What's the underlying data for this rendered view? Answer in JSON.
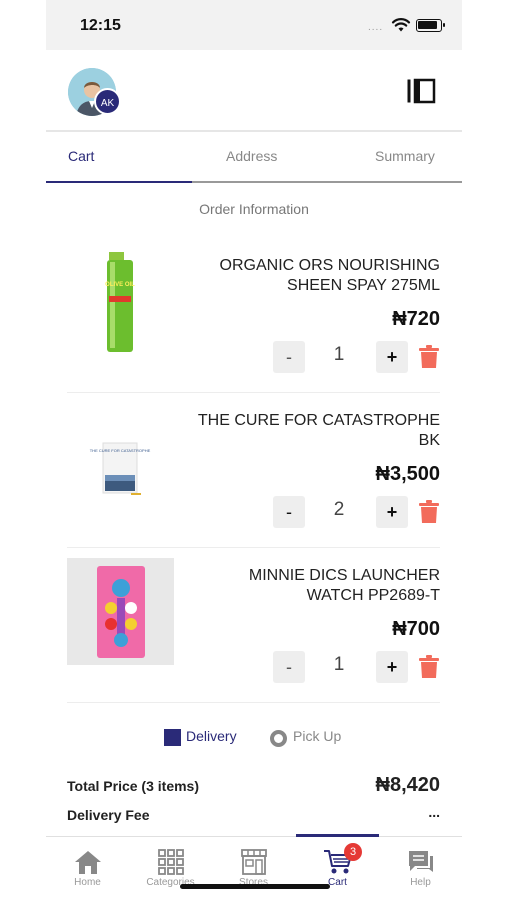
{
  "status_bar": {
    "time": "12:15",
    "dots": "...."
  },
  "header": {
    "avatar_initials": "AK"
  },
  "tabs": [
    {
      "label": "Cart",
      "active": true
    },
    {
      "label": "Address",
      "active": false
    },
    {
      "label": "Summary",
      "active": false
    }
  ],
  "section_title": "Order Information",
  "items": [
    {
      "name": "ORGANIC ORS NOURISHING SHEEN SPAY 275ML",
      "price": "₦720",
      "quantity": "1",
      "minus": "-",
      "plus": "+"
    },
    {
      "name": "THE CURE FOR CATASTROPHE BK",
      "price": "₦3,500",
      "quantity": "2",
      "minus": "-",
      "plus": "+"
    },
    {
      "name": "MINNIE DICS LAUNCHER WATCH PP2689-T",
      "price": "₦700",
      "quantity": "1",
      "minus": "-",
      "plus": "+"
    }
  ],
  "product_image_text": {
    "bottle_label": "OLIVE OIL",
    "book_title": "THE CURE FOR CATASTROPHE"
  },
  "fulfillment": {
    "delivery_label": "Delivery",
    "pickup_label": "Pick Up",
    "selected": "Delivery"
  },
  "totals": {
    "total_label": "Total Price (3 items)",
    "total_value": "₦8,420",
    "fee_label": "Delivery Fee",
    "fee_value": "..."
  },
  "bottom_nav": {
    "items": [
      {
        "label": "Home",
        "icon": "home-icon"
      },
      {
        "label": "Categories",
        "icon": "grid-icon"
      },
      {
        "label": "Stores",
        "icon": "store-icon"
      },
      {
        "label": "Cart",
        "icon": "cart-icon",
        "badge": "3",
        "active": true
      },
      {
        "label": "Help",
        "icon": "chat-icon"
      }
    ]
  },
  "colors": {
    "accent": "#2a2a78",
    "delete": "#f26b5b",
    "badge": "#e53935"
  }
}
